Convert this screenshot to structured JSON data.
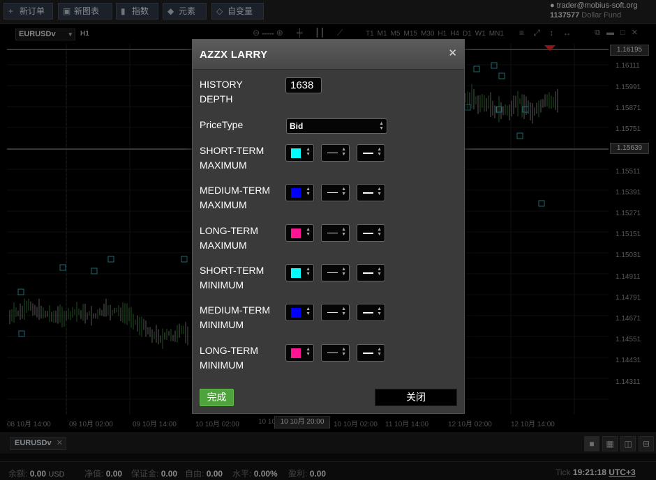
{
  "toolbar": {
    "new_order": "新订单",
    "new_chart": "新图表",
    "indicators": "指数",
    "elements": "元素",
    "variables": "自变量"
  },
  "account": {
    "user": "trader@mobius-soft.org",
    "number": "1137577",
    "fund": "Dollar Fund"
  },
  "chart": {
    "symbol": "EURUSDv",
    "timeframe": "H1",
    "timeframes": [
      "T1",
      "M1",
      "M5",
      "M15",
      "M30",
      "H1",
      "H4",
      "D1",
      "W1",
      "MN1"
    ],
    "price_labels": [
      "1.16111",
      "1.15991",
      "1.15871",
      "1.15751",
      "1.15511",
      "1.15391",
      "1.15271",
      "1.15151",
      "1.15031",
      "1.14911",
      "1.14791",
      "1.14671",
      "1.14551",
      "1.14431",
      "1.14311"
    ],
    "price_box_top": "1.16195",
    "price_box_mid": "1.15639",
    "time_labels": [
      "08 10月 14:00",
      "09 10月 02:00",
      "09 10月 14:00",
      "10 10月 02:00",
      "10 10",
      "10 10月 02:00",
      "11 10月 14:00",
      "12 10月 02:00",
      "12 10月 14:00"
    ],
    "time_box": "10 10月 20:00"
  },
  "tabs": {
    "active": "EURUSDv"
  },
  "status": {
    "balance_label": "余额:",
    "balance_value": "0.00",
    "currency": "USD",
    "equity_label": "净值:",
    "equity_value": "0.00",
    "margin_label": "保证金:",
    "margin_value": "0.00",
    "free_label": "自由:",
    "free_value": "0.00",
    "level_label": "水平:",
    "level_value": "0.00%",
    "profit_label": "盈利:",
    "profit_value": "0.00",
    "tick_label": "Tick",
    "time_value": "19:21:18",
    "timezone": "UTC+3"
  },
  "dialog": {
    "title": "AZZX LARRY",
    "history_depth_label": "HISTORY DEPTH",
    "history_depth_value": "1638",
    "price_type_label": "PriceType",
    "price_type_value": "Bid",
    "rows": [
      {
        "label": "SHORT-TERM MAXIMUM",
        "color": "#00ffff"
      },
      {
        "label": "MEDIUM-TERM MAXIMUM",
        "color": "#0000ff"
      },
      {
        "label": "LONG-TERM MAXIMUM",
        "color": "#ff1493"
      },
      {
        "label": "SHORT-TERM MINIMUM",
        "color": "#00ffff"
      },
      {
        "label": "MEDIUM-TERM MINIMUM",
        "color": "#0000ff"
      },
      {
        "label": "LONG-TERM MINIMUM",
        "color": "#ff1493"
      }
    ],
    "ok_label": "完成",
    "close_label": "关闭"
  }
}
